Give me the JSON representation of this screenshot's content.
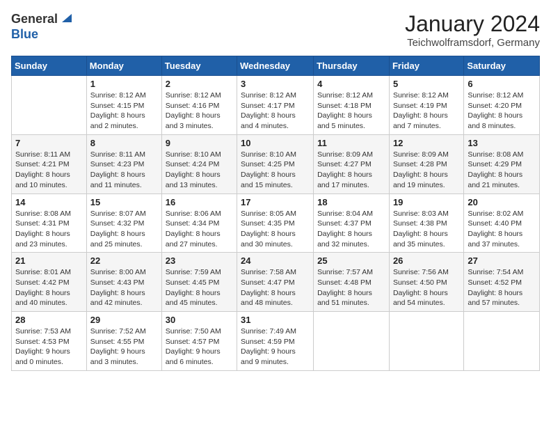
{
  "header": {
    "logo_general": "General",
    "logo_blue": "Blue",
    "month_title": "January 2024",
    "location": "Teichwolframsdorf, Germany"
  },
  "weekdays": [
    "Sunday",
    "Monday",
    "Tuesday",
    "Wednesday",
    "Thursday",
    "Friday",
    "Saturday"
  ],
  "weeks": [
    [
      {
        "day": "",
        "sunrise": "",
        "sunset": "",
        "daylight": ""
      },
      {
        "day": "1",
        "sunrise": "Sunrise: 8:12 AM",
        "sunset": "Sunset: 4:15 PM",
        "daylight": "Daylight: 8 hours and 2 minutes."
      },
      {
        "day": "2",
        "sunrise": "Sunrise: 8:12 AM",
        "sunset": "Sunset: 4:16 PM",
        "daylight": "Daylight: 8 hours and 3 minutes."
      },
      {
        "day": "3",
        "sunrise": "Sunrise: 8:12 AM",
        "sunset": "Sunset: 4:17 PM",
        "daylight": "Daylight: 8 hours and 4 minutes."
      },
      {
        "day": "4",
        "sunrise": "Sunrise: 8:12 AM",
        "sunset": "Sunset: 4:18 PM",
        "daylight": "Daylight: 8 hours and 5 minutes."
      },
      {
        "day": "5",
        "sunrise": "Sunrise: 8:12 AM",
        "sunset": "Sunset: 4:19 PM",
        "daylight": "Daylight: 8 hours and 7 minutes."
      },
      {
        "day": "6",
        "sunrise": "Sunrise: 8:12 AM",
        "sunset": "Sunset: 4:20 PM",
        "daylight": "Daylight: 8 hours and 8 minutes."
      }
    ],
    [
      {
        "day": "7",
        "sunrise": "Sunrise: 8:11 AM",
        "sunset": "Sunset: 4:21 PM",
        "daylight": "Daylight: 8 hours and 10 minutes."
      },
      {
        "day": "8",
        "sunrise": "Sunrise: 8:11 AM",
        "sunset": "Sunset: 4:23 PM",
        "daylight": "Daylight: 8 hours and 11 minutes."
      },
      {
        "day": "9",
        "sunrise": "Sunrise: 8:10 AM",
        "sunset": "Sunset: 4:24 PM",
        "daylight": "Daylight: 8 hours and 13 minutes."
      },
      {
        "day": "10",
        "sunrise": "Sunrise: 8:10 AM",
        "sunset": "Sunset: 4:25 PM",
        "daylight": "Daylight: 8 hours and 15 minutes."
      },
      {
        "day": "11",
        "sunrise": "Sunrise: 8:09 AM",
        "sunset": "Sunset: 4:27 PM",
        "daylight": "Daylight: 8 hours and 17 minutes."
      },
      {
        "day": "12",
        "sunrise": "Sunrise: 8:09 AM",
        "sunset": "Sunset: 4:28 PM",
        "daylight": "Daylight: 8 hours and 19 minutes."
      },
      {
        "day": "13",
        "sunrise": "Sunrise: 8:08 AM",
        "sunset": "Sunset: 4:29 PM",
        "daylight": "Daylight: 8 hours and 21 minutes."
      }
    ],
    [
      {
        "day": "14",
        "sunrise": "Sunrise: 8:08 AM",
        "sunset": "Sunset: 4:31 PM",
        "daylight": "Daylight: 8 hours and 23 minutes."
      },
      {
        "day": "15",
        "sunrise": "Sunrise: 8:07 AM",
        "sunset": "Sunset: 4:32 PM",
        "daylight": "Daylight: 8 hours and 25 minutes."
      },
      {
        "day": "16",
        "sunrise": "Sunrise: 8:06 AM",
        "sunset": "Sunset: 4:34 PM",
        "daylight": "Daylight: 8 hours and 27 minutes."
      },
      {
        "day": "17",
        "sunrise": "Sunrise: 8:05 AM",
        "sunset": "Sunset: 4:35 PM",
        "daylight": "Daylight: 8 hours and 30 minutes."
      },
      {
        "day": "18",
        "sunrise": "Sunrise: 8:04 AM",
        "sunset": "Sunset: 4:37 PM",
        "daylight": "Daylight: 8 hours and 32 minutes."
      },
      {
        "day": "19",
        "sunrise": "Sunrise: 8:03 AM",
        "sunset": "Sunset: 4:38 PM",
        "daylight": "Daylight: 8 hours and 35 minutes."
      },
      {
        "day": "20",
        "sunrise": "Sunrise: 8:02 AM",
        "sunset": "Sunset: 4:40 PM",
        "daylight": "Daylight: 8 hours and 37 minutes."
      }
    ],
    [
      {
        "day": "21",
        "sunrise": "Sunrise: 8:01 AM",
        "sunset": "Sunset: 4:42 PM",
        "daylight": "Daylight: 8 hours and 40 minutes."
      },
      {
        "day": "22",
        "sunrise": "Sunrise: 8:00 AM",
        "sunset": "Sunset: 4:43 PM",
        "daylight": "Daylight: 8 hours and 42 minutes."
      },
      {
        "day": "23",
        "sunrise": "Sunrise: 7:59 AM",
        "sunset": "Sunset: 4:45 PM",
        "daylight": "Daylight: 8 hours and 45 minutes."
      },
      {
        "day": "24",
        "sunrise": "Sunrise: 7:58 AM",
        "sunset": "Sunset: 4:47 PM",
        "daylight": "Daylight: 8 hours and 48 minutes."
      },
      {
        "day": "25",
        "sunrise": "Sunrise: 7:57 AM",
        "sunset": "Sunset: 4:48 PM",
        "daylight": "Daylight: 8 hours and 51 minutes."
      },
      {
        "day": "26",
        "sunrise": "Sunrise: 7:56 AM",
        "sunset": "Sunset: 4:50 PM",
        "daylight": "Daylight: 8 hours and 54 minutes."
      },
      {
        "day": "27",
        "sunrise": "Sunrise: 7:54 AM",
        "sunset": "Sunset: 4:52 PM",
        "daylight": "Daylight: 8 hours and 57 minutes."
      }
    ],
    [
      {
        "day": "28",
        "sunrise": "Sunrise: 7:53 AM",
        "sunset": "Sunset: 4:53 PM",
        "daylight": "Daylight: 9 hours and 0 minutes."
      },
      {
        "day": "29",
        "sunrise": "Sunrise: 7:52 AM",
        "sunset": "Sunset: 4:55 PM",
        "daylight": "Daylight: 9 hours and 3 minutes."
      },
      {
        "day": "30",
        "sunrise": "Sunrise: 7:50 AM",
        "sunset": "Sunset: 4:57 PM",
        "daylight": "Daylight: 9 hours and 6 minutes."
      },
      {
        "day": "31",
        "sunrise": "Sunrise: 7:49 AM",
        "sunset": "Sunset: 4:59 PM",
        "daylight": "Daylight: 9 hours and 9 minutes."
      },
      {
        "day": "",
        "sunrise": "",
        "sunset": "",
        "daylight": ""
      },
      {
        "day": "",
        "sunrise": "",
        "sunset": "",
        "daylight": ""
      },
      {
        "day": "",
        "sunrise": "",
        "sunset": "",
        "daylight": ""
      }
    ]
  ]
}
